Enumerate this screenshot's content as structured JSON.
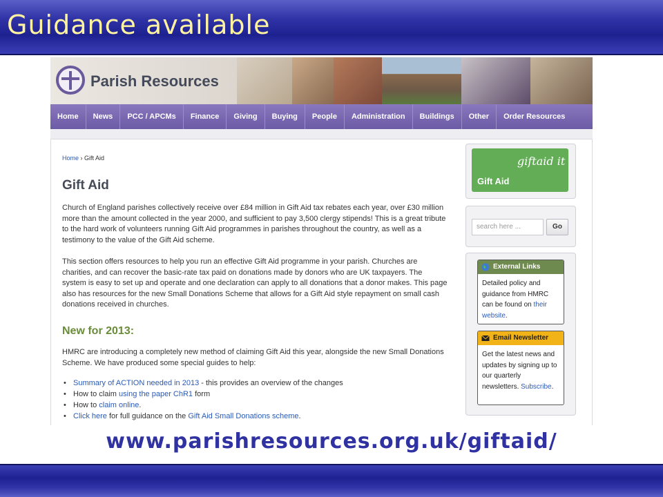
{
  "slide": {
    "title": "Guidance available",
    "url": "www.parishresources.org.uk/giftaid/"
  },
  "site": {
    "brand": "Parish Resources",
    "nav": [
      "Home",
      "News",
      "PCC / APCMs",
      "Finance",
      "Giving",
      "Buying",
      "People",
      "Administration",
      "Buildings",
      "Other",
      "Order Resources"
    ]
  },
  "breadcrumb": {
    "home": "Home",
    "sep": "›",
    "current": "Gift Aid"
  },
  "main": {
    "title": "Gift Aid",
    "p1": "Church of England parishes collectively receive over £84 million in Gift Aid tax rebates each year, over £30 million more than the amount collected in the year 2000, and sufficient to pay 3,500 clergy stipends! This is a great tribute to the hard work of volunteers running Gift Aid programmes in parishes throughout the country, as well as a testimony to the value of the Gift Aid scheme.",
    "p2": "This section offers resources to help you run an effective Gift Aid programme in your parish. Churches are charities, and can recover the basic-rate tax paid on donations made by donors who are UK taxpayers. The system is easy to set up and operate and one declaration can apply to all donations that a donor makes. This page also has resources for the new Small Donations Scheme that allows for a Gift Aid style repayment on small cash donations received in churches.",
    "new_heading": "New for 2013:",
    "p3": "HMRC are introducing a completely new method of claiming Gift Aid this year, alongside the new Small Donations Scheme. We have produced some special guides to help:",
    "list": [
      {
        "link": "Summary of ACTION needed in 2013",
        "text": " - this provides an overview of the changes"
      },
      {
        "pre": "How to claim ",
        "link": "using the paper ChR1",
        "post": " form"
      },
      {
        "pre": "How to ",
        "link": "claim online",
        "post": "."
      },
      {
        "link": "Click here",
        "mid": " for full guidance on the ",
        "link2": "Gift Aid Small Donations scheme",
        "post": "."
      }
    ]
  },
  "sidebar": {
    "giftaid_it": "giftaid it",
    "giftaid_label": "Gift Aid",
    "search_placeholder": "search here ...",
    "go_label": "Go",
    "external": {
      "title": "External Links",
      "body_pre": "Detailed policy and guidance from HMRC can be found on ",
      "link": "their website",
      "post": "."
    },
    "newsletter": {
      "title": "Email Newsletter",
      "body_pre": "Get the latest news and updates by signing up to our quarterly newsletters. ",
      "link": "Subscribe",
      "post": "."
    }
  },
  "colors": {
    "slide_band": "#2f33a6",
    "slide_title": "#fff3a0",
    "nav": "#7a69b2",
    "heading_green": "#6a8c3a",
    "link": "#2a5ab8",
    "giftaid_green": "#62ad56",
    "external_head": "#6f8a4e",
    "newsletter_head": "#f2b318"
  }
}
